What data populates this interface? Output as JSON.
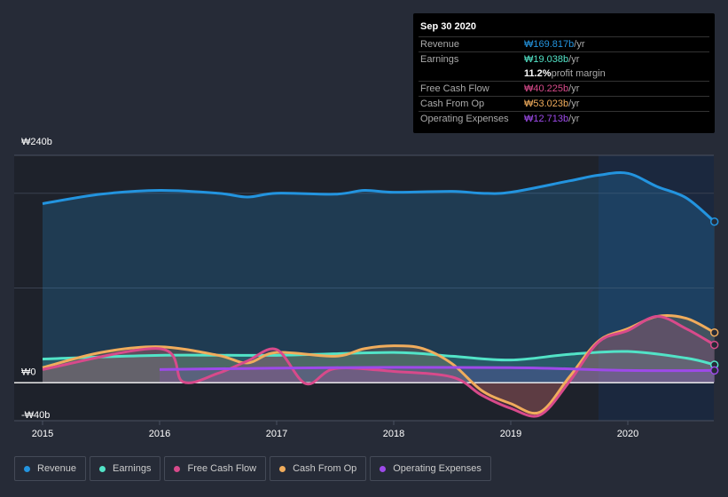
{
  "tooltip": {
    "date": "Sep 30 2020",
    "rows": [
      {
        "label": "Revenue",
        "value": "₩169.817b",
        "unit": " /yr",
        "color": "#2394df"
      },
      {
        "label": "Earnings",
        "value": "₩19.038b",
        "unit": " /yr",
        "color": "#52e3c7"
      },
      {
        "label": "",
        "value": "11.2%",
        "unit": " profit margin",
        "color": "#ffffff"
      },
      {
        "label": "Free Cash Flow",
        "value": "₩40.225b",
        "unit": " /yr",
        "color": "#d84a8b"
      },
      {
        "label": "Cash From Op",
        "value": "₩53.023b",
        "unit": " /yr",
        "color": "#f0ac5c"
      },
      {
        "label": "Operating Expenses",
        "value": "₩12.713b",
        "unit": " /yr",
        "color": "#9d4ae9"
      }
    ]
  },
  "chart_data": {
    "type": "area",
    "ylim": [
      -40,
      240
    ],
    "yticks": [
      {
        "v": 240,
        "label": "₩240b"
      },
      {
        "v": 0,
        "label": "₩0"
      },
      {
        "v": -40,
        "label": "-₩40b"
      }
    ],
    "xlim": [
      2014.75,
      2020.74
    ],
    "xticks": [
      2015,
      2016,
      2017,
      2018,
      2019,
      2020
    ],
    "forecast_shade_start": 2019.75,
    "series": [
      {
        "name": "Revenue",
        "color": "#2394df",
        "x": [
          2015,
          2015.5,
          2016,
          2016.5,
          2016.75,
          2017,
          2017.5,
          2017.75,
          2018,
          2018.5,
          2018.75,
          2019,
          2019.5,
          2019.75,
          2020,
          2020.25,
          2020.5,
          2020.74
        ],
        "values": [
          189,
          199,
          203,
          200,
          196,
          200,
          199,
          203,
          201,
          202,
          200,
          201,
          213,
          219,
          221,
          207,
          195,
          170
        ]
      },
      {
        "name": "Earnings",
        "color": "#52e3c7",
        "x": [
          2015,
          2016,
          2017,
          2018,
          2018.5,
          2019,
          2019.5,
          2020,
          2020.5,
          2020.74
        ],
        "values": [
          25,
          29,
          29,
          32,
          28,
          24,
          30,
          33,
          26,
          19
        ]
      },
      {
        "name": "Free Cash Flow",
        "color": "#d84a8b",
        "x": [
          2015,
          2016,
          2016.2,
          2016.5,
          2016.75,
          2017,
          2017.25,
          2017.5,
          2018,
          2018.5,
          2018.75,
          2019,
          2019.25,
          2019.5,
          2019.75,
          2020,
          2020.25,
          2020.5,
          2020.74
        ],
        "values": [
          14,
          36,
          1,
          10,
          23,
          35,
          -1,
          15,
          12,
          6,
          -13,
          -27,
          -34,
          1,
          43,
          55,
          70,
          57,
          40
        ]
      },
      {
        "name": "Cash From Op",
        "color": "#f0ac5c",
        "x": [
          2015,
          2015.5,
          2016,
          2016.5,
          2016.75,
          2017,
          2017.5,
          2017.75,
          2018,
          2018.25,
          2018.5,
          2018.75,
          2019,
          2019.25,
          2019.5,
          2019.75,
          2020,
          2020.25,
          2020.5,
          2020.74
        ],
        "values": [
          16,
          32,
          38,
          29,
          21,
          32,
          28,
          36,
          39,
          36,
          20,
          -8,
          -22,
          -31,
          6,
          44,
          57,
          70,
          68,
          53
        ]
      },
      {
        "name": "Operating Expenses",
        "color": "#9d4ae9",
        "x": [
          2016,
          2017.5,
          2019,
          2020,
          2020.74
        ],
        "values": [
          14,
          16,
          16,
          13,
          13
        ]
      }
    ]
  },
  "legend": [
    "Revenue",
    "Earnings",
    "Free Cash Flow",
    "Cash From Op",
    "Operating Expenses"
  ]
}
